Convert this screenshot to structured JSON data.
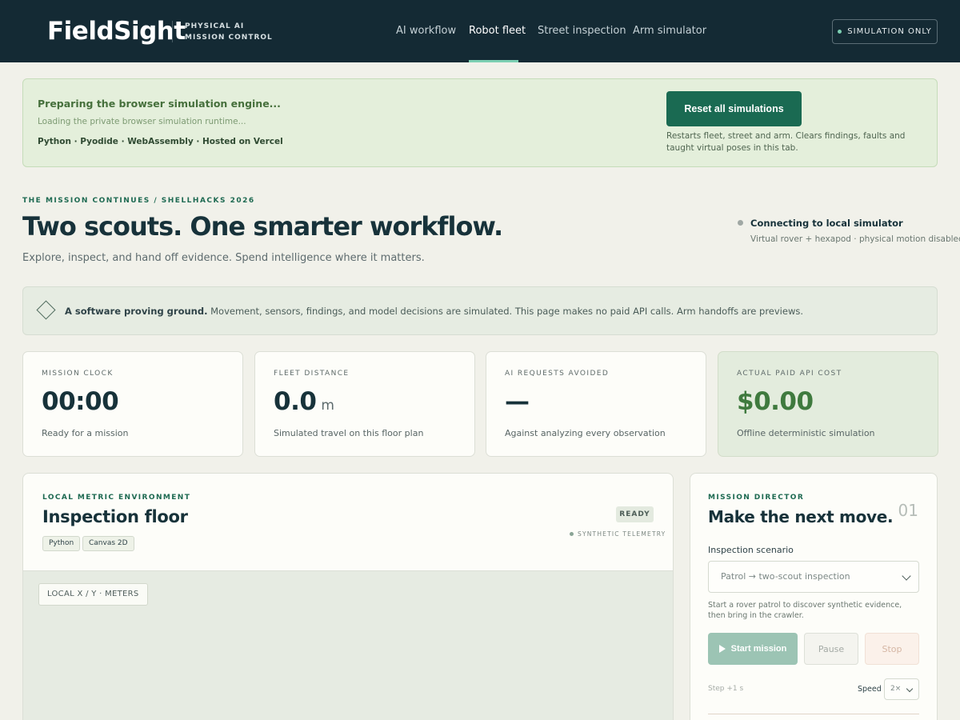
{
  "header": {
    "brand": "FieldSight",
    "brand_sub_line1": "PHYSICAL AI",
    "brand_sub_line2": "MISSION CONTROL",
    "nav": [
      {
        "label": "AI workflow",
        "active": false
      },
      {
        "label": "Robot fleet",
        "active": true
      },
      {
        "label": "Street inspection",
        "active": false
      },
      {
        "label": "Arm simulator",
        "active": false
      }
    ],
    "badge": "SIMULATION ONLY"
  },
  "banner": {
    "title": "Preparing the browser simulation engine...",
    "subtitle": "Loading the private browser simulation runtime...",
    "tech": "Python · Pyodide · WebAssembly · Hosted on Vercel",
    "reset_button": "Reset all simulations",
    "reset_note": "Restarts fleet, street and arm. Clears findings, faults and taught virtual poses in this tab."
  },
  "hero": {
    "eyebrow": "THE MISSION CONTINUES / SHELLHACKS 2026",
    "title": "Two scouts. One smarter workflow.",
    "subtitle": "Explore, inspect, and hand off evidence. Spend intelligence where it matters.",
    "status_title": "Connecting to local simulator",
    "status_sub": "Virtual rover + hexapod · physical motion disabled"
  },
  "notice": {
    "bold": "A software proving ground.",
    "text": " Movement, sensors, findings, and model decisions are simulated. This page makes no paid API calls. Arm handoffs are previews."
  },
  "metrics": [
    {
      "label": "MISSION CLOCK",
      "value": "00:00",
      "unit": "",
      "note": "Ready for a mission"
    },
    {
      "label": "FLEET DISTANCE",
      "value": "0.0",
      "unit": "m",
      "note": "Simulated travel on this floor plan"
    },
    {
      "label": "AI REQUESTS AVOIDED",
      "value": "—",
      "unit": "",
      "note": "Against analyzing every observation"
    },
    {
      "label": "ACTUAL PAID API COST",
      "value": "$0.00",
      "unit": "",
      "note": "Offline deterministic simulation"
    }
  ],
  "floor": {
    "eyebrow": "LOCAL METRIC ENVIRONMENT",
    "title": "Inspection floor",
    "tags": [
      "Python",
      "Canvas 2D"
    ],
    "status": "READY",
    "telemetry": "SYNTHETIC TELEMETRY",
    "axis_label": "LOCAL X / Y · METERS"
  },
  "director": {
    "eyebrow": "MISSION DIRECTOR",
    "number": "01",
    "title": "Make the next move.",
    "scenario_label": "Inspection scenario",
    "scenario_value": "Patrol → two-scout inspection",
    "help": "Start a rover patrol to discover synthetic evidence, then bring in the crawler.",
    "start_button": "Start mission",
    "pause_button": "Pause",
    "stop_button": "Stop",
    "step": "Step +1 s",
    "speed_label": "Speed",
    "speed_value": "2×"
  }
}
